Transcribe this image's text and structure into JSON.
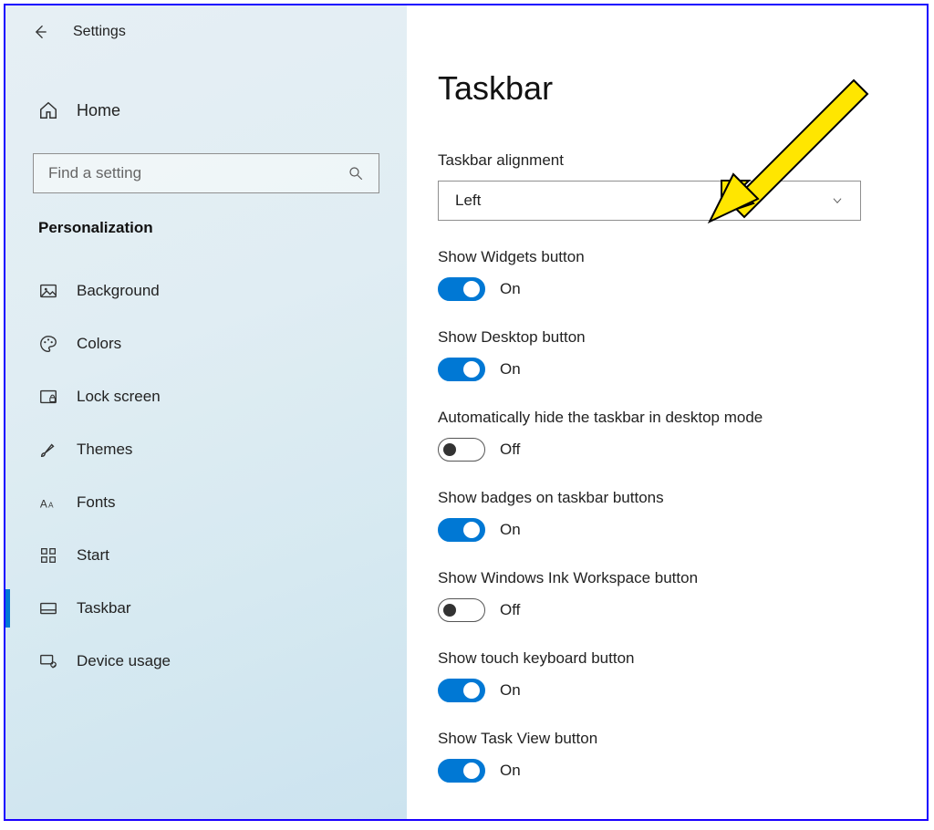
{
  "header": {
    "app_title": "Settings"
  },
  "sidebar": {
    "home_label": "Home",
    "search_placeholder": "Find a setting",
    "category_label": "Personalization",
    "items": [
      {
        "id": "background",
        "label": "Background",
        "icon": "picture-icon"
      },
      {
        "id": "colors",
        "label": "Colors",
        "icon": "palette-icon"
      },
      {
        "id": "lockscreen",
        "label": "Lock screen",
        "icon": "lock-screen-icon"
      },
      {
        "id": "themes",
        "label": "Themes",
        "icon": "brush-icon"
      },
      {
        "id": "fonts",
        "label": "Fonts",
        "icon": "fonts-icon"
      },
      {
        "id": "start",
        "label": "Start",
        "icon": "start-grid-icon"
      },
      {
        "id": "taskbar",
        "label": "Taskbar",
        "icon": "taskbar-icon",
        "active": true
      },
      {
        "id": "deviceusage",
        "label": "Device usage",
        "icon": "device-usage-icon"
      }
    ]
  },
  "main": {
    "page_title": "Taskbar",
    "alignment": {
      "label": "Taskbar alignment",
      "value": "Left"
    },
    "toggles": [
      {
        "label": "Show Widgets button",
        "state": "On",
        "on": true
      },
      {
        "label": "Show Desktop button",
        "state": "On",
        "on": true
      },
      {
        "label": "Automatically hide the taskbar in desktop mode",
        "state": "Off",
        "on": false
      },
      {
        "label": "Show badges on taskbar buttons",
        "state": "On",
        "on": true
      },
      {
        "label": "Show Windows Ink Workspace button",
        "state": "Off",
        "on": false
      },
      {
        "label": "Show touch keyboard button",
        "state": "On",
        "on": true
      },
      {
        "label": "Show Task View button",
        "state": "On",
        "on": true
      }
    ]
  },
  "annotation": {
    "arrow_color": "#ffe600",
    "arrow_stroke": "#000000"
  }
}
